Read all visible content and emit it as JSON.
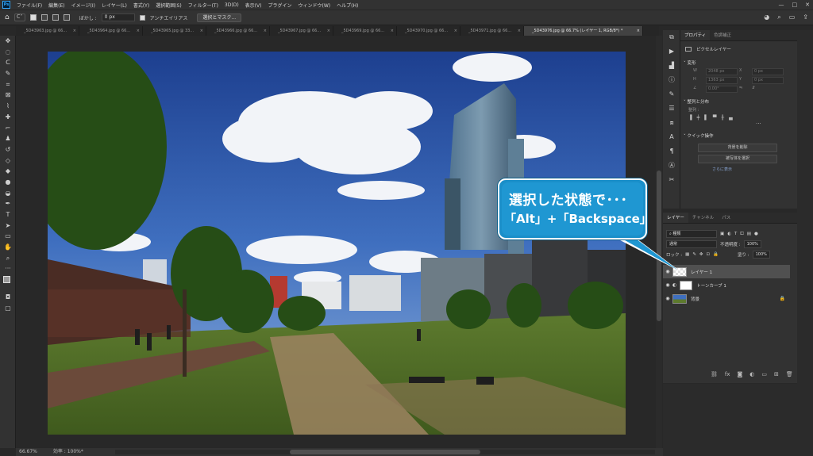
{
  "menubar": {
    "logo": "Ps",
    "items": [
      "ファイル(F)",
      "編集(E)",
      "イメージ(I)",
      "レイヤー(L)",
      "書式(Y)",
      "選択範囲(S)",
      "フィルター(T)",
      "3D(D)",
      "表示(V)",
      "プラグイン",
      "ウィンドウ(W)",
      "ヘルプ(H)"
    ],
    "window_controls": [
      "—",
      "□",
      "✕"
    ]
  },
  "options": {
    "feather_label": "ぼかし :",
    "feather_value": "0 px",
    "antialias_label": "アンチエイリアス",
    "select_mask_button": "選択とマスク..."
  },
  "tabs": [
    {
      "label": "_5D43963.jpg @ 66..."
    },
    {
      "label": "_5D43964.jpg @ 66..."
    },
    {
      "label": "_5D43965.jpg @ 33..."
    },
    {
      "label": "_5D43966.jpg @ 66..."
    },
    {
      "label": "_5D43967.jpg @ 66..."
    },
    {
      "label": "_5D43969.jpg @ 66..."
    },
    {
      "label": "_5D43970.jpg @ 66..."
    },
    {
      "label": "_5D43971.jpg @ 66..."
    },
    {
      "label": "_5D43976.jpg @ 66.7% (レイヤー 1, RGB/8*) *",
      "active": true
    }
  ],
  "status": {
    "zoom": "66.67%",
    "efficiency": "効率 : 100%*"
  },
  "properties": {
    "tabs": [
      "プロパティ",
      "色調補正"
    ],
    "type": "ピクセルレイヤー",
    "transform_header": "変形",
    "w_label": "W",
    "w_value": "2048 px",
    "x_label": "X",
    "x_value": "0 px",
    "h_label": "H",
    "h_value": "1363 px",
    "y_label": "Y",
    "y_value": "0 px",
    "angle_value": "0.00°",
    "align_header": "整列と分布",
    "align_sub": "整列 :",
    "quick_header": "クイック操作",
    "quick_btn1": "背景を削除",
    "quick_btn2": "被写体を選択",
    "quick_link": "さらに表示"
  },
  "layers_panel": {
    "tabs": [
      "レイヤー",
      "チャンネル",
      "パス"
    ],
    "filter_kind": "種類",
    "blend_mode": "通常",
    "opacity_label": "不透明度 :",
    "opacity_value": "100%",
    "lock_label": "ロック :",
    "fill_label": "塗り :",
    "fill_value": "100%",
    "layers": [
      {
        "name": "レイヤー 1",
        "selected": true
      },
      {
        "name": "トーンカーブ 1"
      },
      {
        "name": "背景"
      }
    ]
  },
  "callout": {
    "line1": "選択した状態で･･･",
    "line2": "「Alt」+「Backspace」"
  }
}
